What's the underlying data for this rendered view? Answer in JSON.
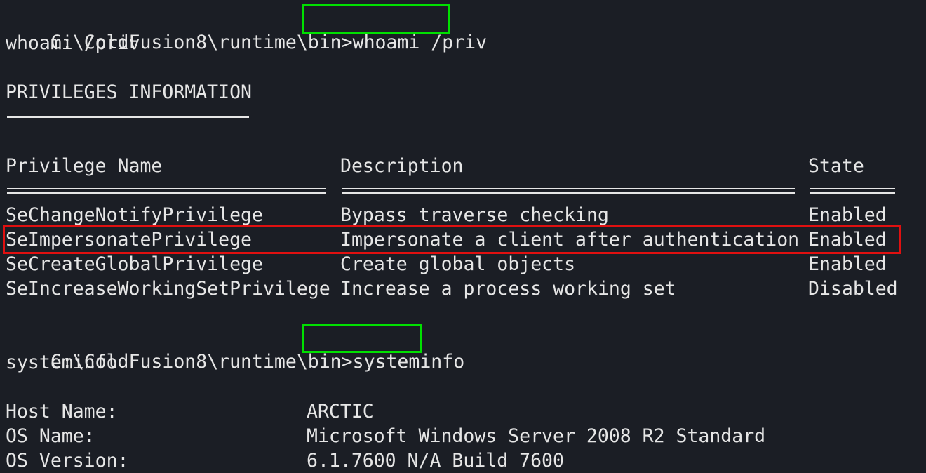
{
  "terminal": {
    "prompt": "C:\\ColdFusion8\\runtime\\bin>",
    "cmd1": "whoami /priv",
    "cmd1_echo": "whoami /priv",
    "section_title": "PRIVILEGES INFORMATION",
    "headers": {
      "name": "Privilege Name",
      "description": "Description",
      "state": "State"
    },
    "privileges": [
      {
        "name": "SeChangeNotifyPrivilege",
        "description": "Bypass traverse checking",
        "state": "Enabled"
      },
      {
        "name": "SeImpersonatePrivilege",
        "description": "Impersonate a client after authentication",
        "state": "Enabled"
      },
      {
        "name": "SeCreateGlobalPrivilege",
        "description": "Create global objects",
        "state": "Enabled"
      },
      {
        "name": "SeIncreaseWorkingSetPrivilege",
        "description": "Increase a process working set",
        "state": "Disabled"
      }
    ],
    "cmd2": "systeminfo",
    "cmd2_echo": "systeminfo",
    "sysinfo": [
      {
        "key": "Host Name:",
        "value": "ARCTIC"
      },
      {
        "key": "OS Name:",
        "value": "Microsoft Windows Server 2008 R2 Standard"
      },
      {
        "key": "OS Version:",
        "value": "6.1.7600 N/A Build 7600"
      }
    ]
  },
  "colors": {
    "background": "#1b1e25",
    "text": "#e6e6e6",
    "highlight_green": "#00e000",
    "highlight_red": "#e01010"
  }
}
